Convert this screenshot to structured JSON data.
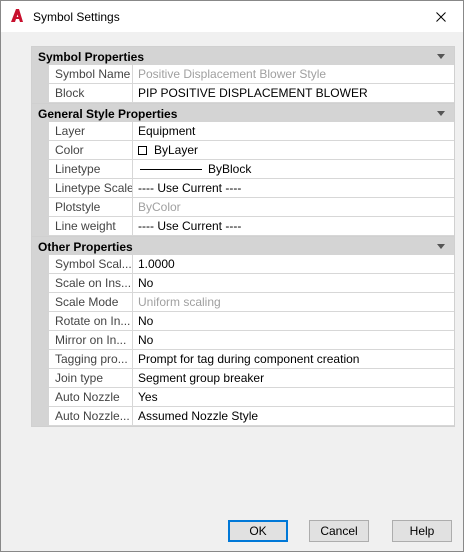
{
  "window": {
    "title": "Symbol Settings"
  },
  "colors": {
    "category_bg": "#d4d4d4",
    "disabled_text": "#a0a0a0",
    "accent": "#0078d7",
    "app_icon": "#c8102e"
  },
  "categories": [
    {
      "label": "Symbol Properties",
      "props": [
        {
          "name": "Symbol Name",
          "value": "Positive Displacement Blower Style",
          "disabled": true
        },
        {
          "name": "Block",
          "value": "PIP POSITIVE DISPLACEMENT BLOWER",
          "disabled": false
        }
      ]
    },
    {
      "label": "General Style Properties",
      "props": [
        {
          "name": "Layer",
          "value": "Equipment",
          "disabled": false
        },
        {
          "name": "Color",
          "value": "ByLayer",
          "disabled": false
        },
        {
          "name": "Linetype",
          "value": "ByBlock",
          "disabled": false
        },
        {
          "name": "Linetype Scale",
          "value": "---- Use Current ----",
          "disabled": false
        },
        {
          "name": "Plotstyle",
          "value": "ByColor",
          "disabled": true
        },
        {
          "name": "Line weight",
          "value": "---- Use Current ----",
          "disabled": false
        }
      ]
    },
    {
      "label": "Other Properties",
      "props": [
        {
          "name": "Symbol Scal...",
          "value": "1.0000",
          "disabled": false
        },
        {
          "name": "Scale on Ins...",
          "value": "No",
          "disabled": false
        },
        {
          "name": "Scale Mode",
          "value": "Uniform scaling",
          "disabled": true
        },
        {
          "name": "Rotate on In...",
          "value": "No",
          "disabled": false
        },
        {
          "name": "Mirror on In...",
          "value": "No",
          "disabled": false
        },
        {
          "name": "Tagging pro...",
          "value": "Prompt for tag during component creation",
          "disabled": false
        },
        {
          "name": "Join type",
          "value": "Segment group breaker",
          "disabled": false
        },
        {
          "name": "Auto Nozzle",
          "value": "Yes",
          "disabled": false
        },
        {
          "name": "Auto Nozzle...",
          "value": "Assumed Nozzle Style",
          "disabled": false
        }
      ]
    }
  ],
  "buttons": {
    "ok": "OK",
    "cancel": "Cancel",
    "help": "Help"
  }
}
